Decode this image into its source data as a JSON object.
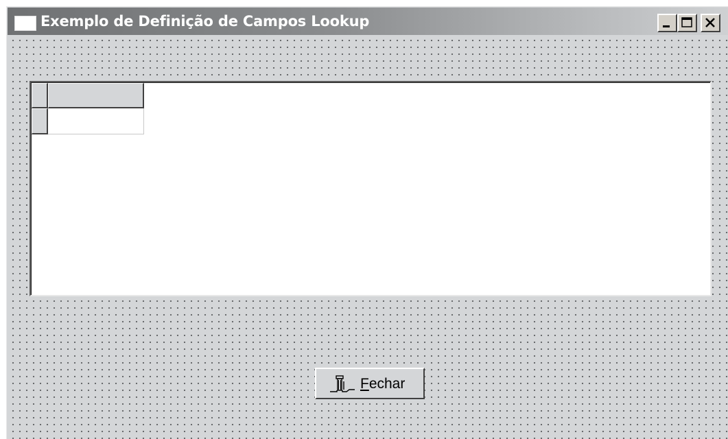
{
  "window": {
    "title": "Exemplo de Definição de Campos Lookup",
    "controls": {
      "minimize_icon": "minimize-icon",
      "maximize_icon": "maximize-icon",
      "close_icon": "close-icon"
    }
  },
  "grid": {
    "columns": [
      ""
    ],
    "rows": [
      [
        ""
      ]
    ]
  },
  "close_button": {
    "accelerator": "F",
    "label_rest": "echar",
    "icon": "door-exit-icon"
  },
  "colors": {
    "form_background": "#d4d6d8",
    "title_gradient_start": "#6f7173",
    "title_gradient_end": "#cfd1d3",
    "grid_background": "#ffffff"
  }
}
